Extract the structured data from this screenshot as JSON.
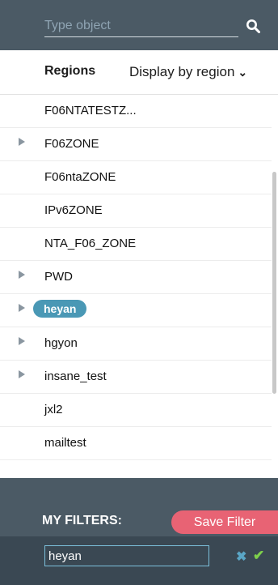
{
  "search": {
    "placeholder": "Type object"
  },
  "header": {
    "regions_label": "Regions",
    "display_select": "Display by region"
  },
  "items": [
    {
      "label": "F06NTATESTZ...",
      "expandable": false
    },
    {
      "label": "F06ZONE",
      "expandable": true
    },
    {
      "label": "F06ntaZONE",
      "expandable": false
    },
    {
      "label": "IPv6ZONE",
      "expandable": false
    },
    {
      "label": "NTA_F06_ZONE",
      "expandable": false
    },
    {
      "label": "PWD",
      "expandable": true
    },
    {
      "label": "heyan",
      "expandable": true,
      "highlighted": true
    },
    {
      "label": "hgyon",
      "expandable": true
    },
    {
      "label": "insane_test",
      "expandable": true
    },
    {
      "label": "jxl2",
      "expandable": false
    },
    {
      "label": "mailtest",
      "expandable": false
    }
  ],
  "filters": {
    "title": "MY FILTERS:",
    "save_label": "Save Filter",
    "current_value": "heyan"
  },
  "colors": {
    "panel_bg": "#4b5a65",
    "accent_pill": "#4a98b5",
    "save_button": "#e86374",
    "confirm": "#7ed04b"
  }
}
